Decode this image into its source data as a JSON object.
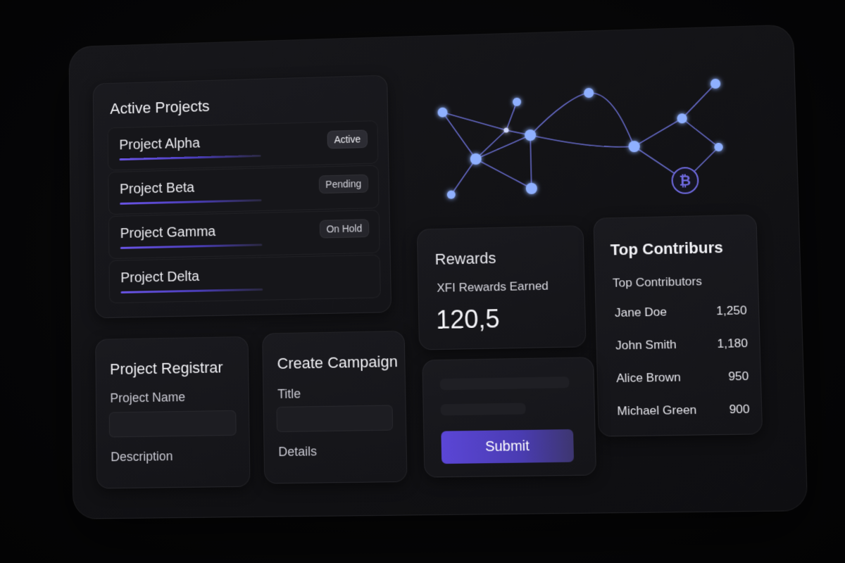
{
  "projects": {
    "title": "Active Projects",
    "items": [
      {
        "name": "Project Alpha",
        "status": "Active"
      },
      {
        "name": "Project Beta",
        "status": "Pending"
      },
      {
        "name": "Project Gamma",
        "status": "On Hold"
      },
      {
        "name": "Project Delta",
        "status": ""
      }
    ]
  },
  "rewards": {
    "title": "Rewards",
    "subtitle": "XFI Rewards Earned",
    "value": "120,5"
  },
  "contributors": {
    "title": "Top Contriburs",
    "subtitle": "Top Contributors",
    "items": [
      {
        "name": "Jane Doe",
        "score": "1,250"
      },
      {
        "name": "John Smith",
        "score": "1,180"
      },
      {
        "name": "Alice Brown",
        "score": "950"
      },
      {
        "name": "Michael Green",
        "score": "900"
      }
    ]
  },
  "registrar": {
    "title": "Project Registrar",
    "name_label": "Project Name",
    "description_label": "Description"
  },
  "campaign": {
    "title": "Create Campaign",
    "title_label": "Title",
    "details_label": "Details"
  },
  "form": {
    "submit_label": "Submit"
  },
  "network": {
    "icon": "bitcoin-icon",
    "accent": "#7aa7ff",
    "line_color": "#6d72d8"
  },
  "colors": {
    "accent": "#5b46d6",
    "background": "#0b0b0e"
  }
}
